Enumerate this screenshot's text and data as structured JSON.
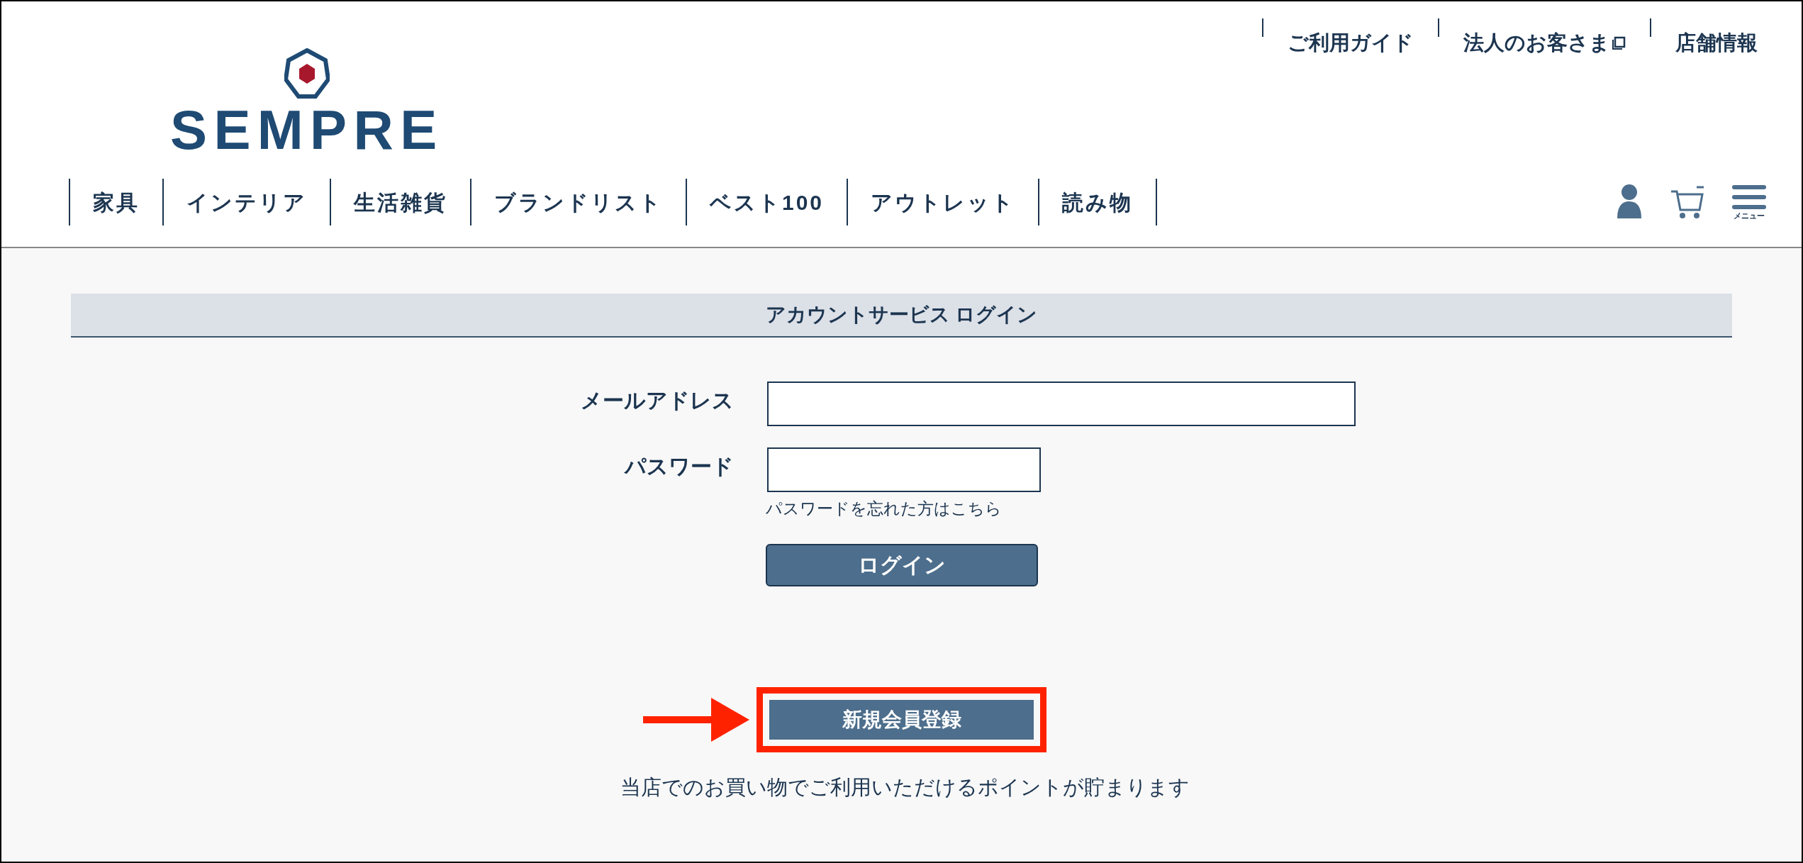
{
  "header": {
    "logo": "SEMPRE",
    "top_links": [
      {
        "label": "ご利用ガイド",
        "external": false
      },
      {
        "label": "法人のお客さま",
        "external": true
      },
      {
        "label": "店舗情報",
        "external": false
      }
    ],
    "nav": [
      {
        "label": "家具"
      },
      {
        "label": "インテリア"
      },
      {
        "label": "生活雑貨"
      },
      {
        "label": "ブランドリスト"
      },
      {
        "label": "ベスト100"
      },
      {
        "label": "アウトレット"
      },
      {
        "label": "読み物"
      }
    ],
    "menu_label": "メニュー"
  },
  "login": {
    "title": "アカウントサービス ログイン",
    "fields": [
      {
        "label": "メールアドレス",
        "kind": "wide"
      },
      {
        "label": "パスワード",
        "kind": "narrow"
      }
    ],
    "forgot_link": "パスワードを忘れた方はこちら",
    "login_button": "ログイン",
    "register_button": "新規会員登録",
    "register_highlighted": true,
    "register_note": "当店でのお買い物でご利用いただけるポイントが貯まります"
  }
}
